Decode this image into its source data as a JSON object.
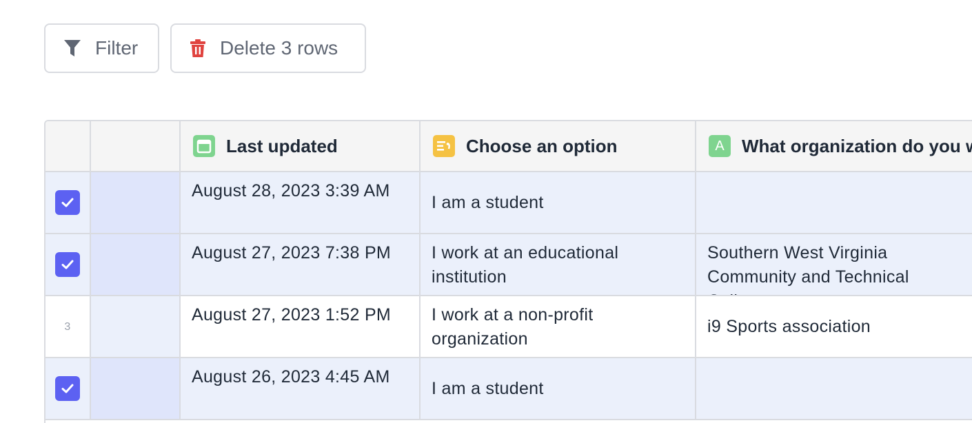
{
  "toolbar": {
    "filter_label": "Filter",
    "delete_label": "Delete 3 rows"
  },
  "columns": [
    {
      "label": "Last updated",
      "icon": "calendar-icon",
      "color": "#7fd48f"
    },
    {
      "label": "Choose an option",
      "icon": "single-select-icon",
      "color": "#f5c243"
    },
    {
      "label": "What organization do you w",
      "icon": "text-field-icon",
      "icon_glyph": "A",
      "color": "#7fd48f"
    }
  ],
  "rows": [
    {
      "selected": true,
      "last_updated": "August 28, 2023 3:39 AM",
      "option": "I am a student",
      "organization": ""
    },
    {
      "selected": true,
      "last_updated": "August 27, 2023 7:38 PM",
      "option": "I work at an educational institution",
      "organization": "Southern West Virginia Community and Technical College"
    },
    {
      "selected": false,
      "row_number": "3",
      "last_updated": "August 27, 2023 1:52 PM",
      "option": "I work at a non-profit organization",
      "organization": "i9 Sports association"
    },
    {
      "selected": true,
      "last_updated": "August 26, 2023 4:45 AM",
      "option": "I am a student",
      "organization": ""
    }
  ],
  "colors": {
    "accent": "#5c61f2",
    "delete_icon": "#e0433f",
    "selected_row": "#ebf0fb"
  }
}
